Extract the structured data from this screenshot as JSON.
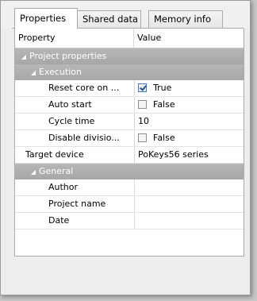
{
  "tabs": [
    {
      "label": "Properties"
    },
    {
      "label": "Shared data"
    },
    {
      "label": "Memory info"
    }
  ],
  "grid": {
    "col_property": "Property",
    "col_value": "Value"
  },
  "categories": {
    "project": "Project properties",
    "execution": "Execution",
    "general": "General"
  },
  "rows": {
    "reset_core": {
      "label": "Reset core on ...",
      "value": "True",
      "checked": true
    },
    "auto_start": {
      "label": "Auto start",
      "value": "False",
      "checked": false
    },
    "cycle_time": {
      "label": "Cycle time",
      "value": "10"
    },
    "disable_division": {
      "label": "Disable divisio...",
      "value": "False",
      "checked": false
    },
    "target_device": {
      "label": "Target device",
      "value": "PoKeys56 series"
    },
    "author": {
      "label": "Author",
      "value": ""
    },
    "project_name": {
      "label": "Project name",
      "value": ""
    },
    "date": {
      "label": "Date",
      "value": ""
    }
  },
  "icons": {
    "expanded": "triangle-down-icon"
  }
}
